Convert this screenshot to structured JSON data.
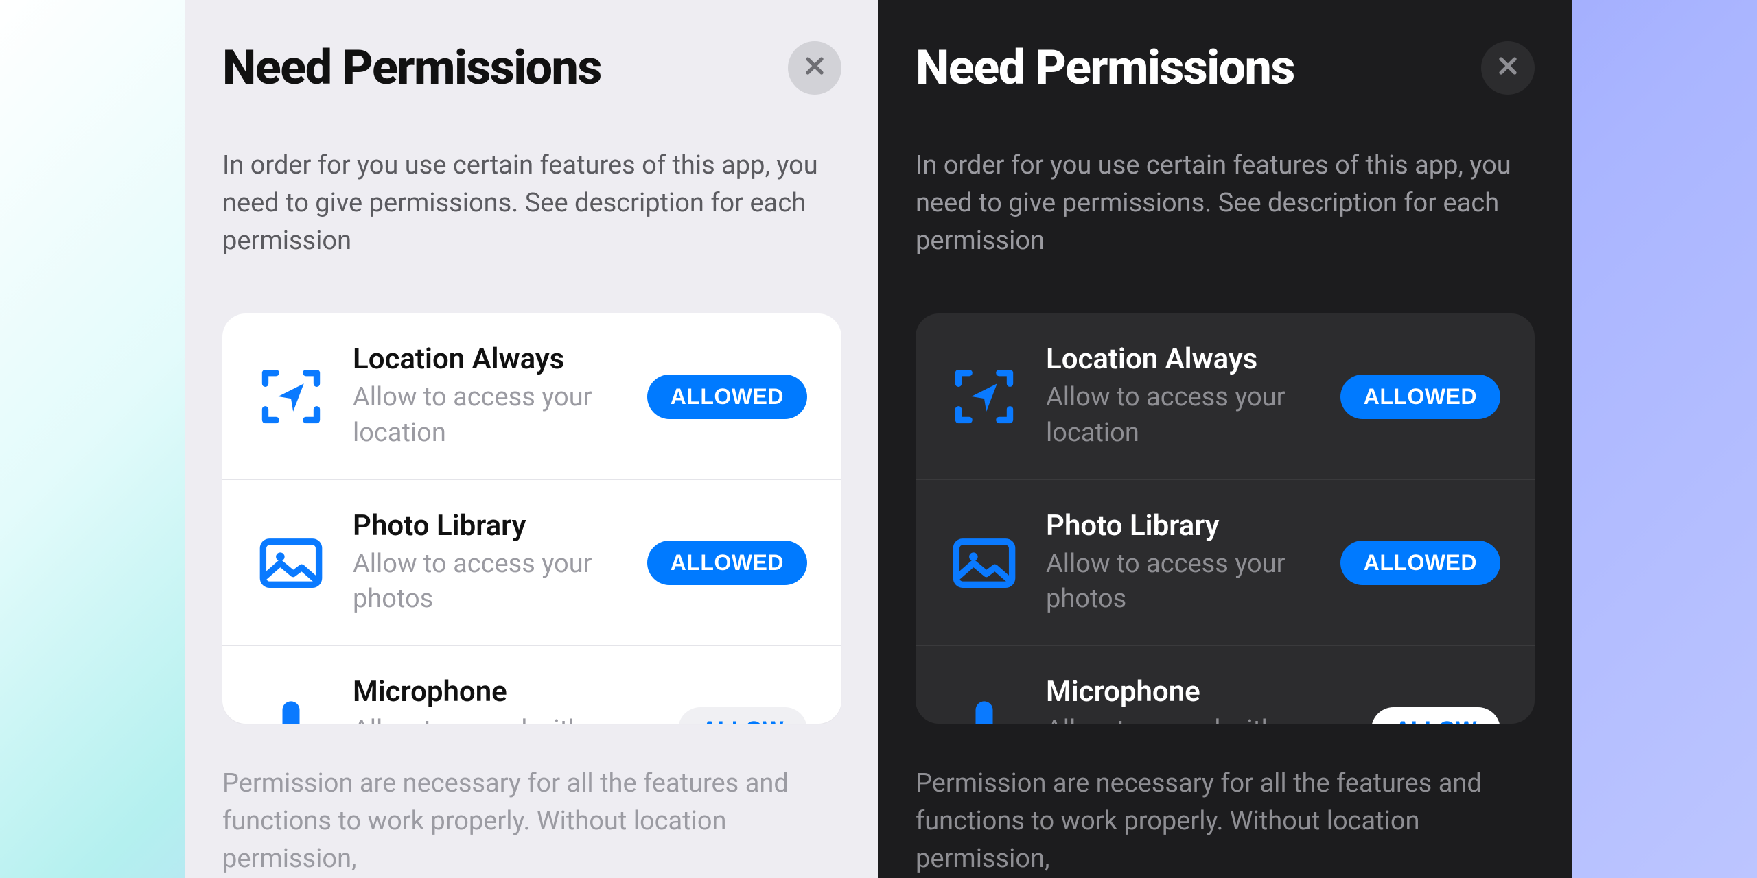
{
  "title": "Need Permissions",
  "intro": "In order for you use certain features of this app, you need to give permissions. See description for each permission",
  "permissions": [
    {
      "icon": "location",
      "title": "Location Always",
      "desc": "Allow to access your location",
      "state": "allowed",
      "btn": "ALLOWED"
    },
    {
      "icon": "photo",
      "title": "Photo Library",
      "desc": "Allow to access your photos",
      "state": "allowed",
      "btn": "ALLOWED"
    },
    {
      "icon": "mic",
      "title": "Microphone",
      "desc": "Allow to record with microphone",
      "state": "allow",
      "btn": "ALLOW"
    }
  ],
  "footnote": "Permission are necessary for all the features and functions to work properly. Without location permission,",
  "colors": {
    "accent": "#007aff"
  }
}
